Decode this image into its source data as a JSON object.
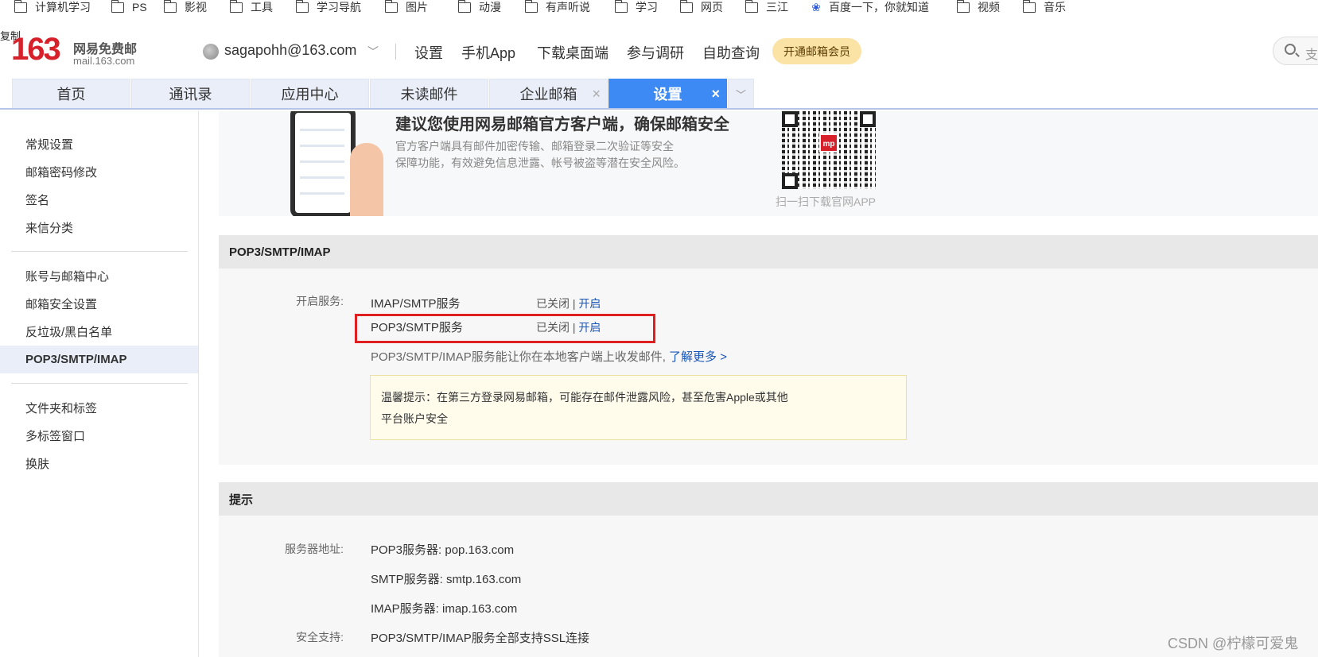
{
  "bookmarks": [
    "计算机学习",
    "PS",
    "影视",
    "工具",
    "学习导航",
    "图片",
    "动漫",
    "有声听说",
    "学习",
    "网页",
    "三江",
    "百度一下，你就知道",
    "视频",
    "音乐"
  ],
  "header": {
    "copy_label": "复制",
    "logo_number": "163",
    "logo_name": "网易免费邮",
    "logo_domain": "mail.163.com",
    "account": "sagapohh@163.com",
    "links": [
      "设置",
      "手机App",
      "下载桌面端",
      "参与调研",
      "自助查询"
    ],
    "vip_button": "开通邮箱会员",
    "search_placeholder": "支"
  },
  "tabs": [
    {
      "label": "首页"
    },
    {
      "label": "通讯录"
    },
    {
      "label": "应用中心"
    },
    {
      "label": "未读邮件"
    },
    {
      "label": "企业邮箱",
      "close": "×"
    },
    {
      "label": "设置",
      "close": "×",
      "active": true
    }
  ],
  "sidebar": {
    "group1": [
      "常规设置",
      "邮箱密码修改",
      "签名",
      "来信分类"
    ],
    "group2": [
      "账号与邮箱中心",
      "邮箱安全设置",
      "反垃圾/黑白名单",
      "POP3/SMTP/IMAP"
    ],
    "group3": [
      "文件夹和标签",
      "多标签窗口",
      "换肤"
    ],
    "active": "POP3/SMTP/IMAP"
  },
  "banner": {
    "title": "建议您使用网易邮箱官方客户端，确保邮箱安全",
    "desc_line1": "官方客户端具有邮件加密传输、邮箱登录二次验证等安全",
    "desc_line2": "保障功能，有效避免信息泄露、帐号被盗等潜在安全风险。",
    "qr_logo": "mp",
    "qr_caption": "扫一扫下载官网APP"
  },
  "pop_section": {
    "title": "POP3/SMTP/IMAP",
    "service_label": "开启服务:",
    "services": [
      {
        "name": "IMAP/SMTP服务",
        "status": "已关闭",
        "sep": "|",
        "action": "开启"
      },
      {
        "name": "POP3/SMTP服务",
        "status": "已关闭",
        "sep": "|",
        "action": "开启"
      }
    ],
    "note": "POP3/SMTP/IMAP服务能让你在本地客户端上收发邮件,",
    "learn_more": "了解更多 >",
    "warning_line1": "温馨提示：在第三方登录网易邮箱，可能存在邮件泄露风险，甚至危害Apple或其他",
    "warning_line2": "平台账户安全"
  },
  "tips_section": {
    "title": "提示",
    "server_label": "服务器地址:",
    "servers": [
      "POP3服务器: pop.163.com",
      "SMTP服务器: smtp.163.com",
      "IMAP服务器: imap.163.com"
    ],
    "security_label": "安全支持:",
    "security_text": "POP3/SMTP/IMAP服务全部支持SSL连接"
  },
  "watermark": "CSDN @柠檬可爱鬼",
  "colors": {
    "brand_red": "#d6212b",
    "tab_active": "#3d8af5",
    "link": "#1a56b8",
    "highlight": "#e02020"
  }
}
